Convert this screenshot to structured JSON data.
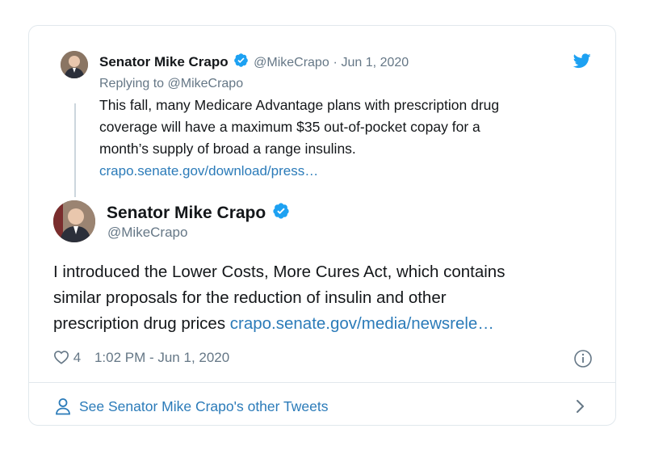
{
  "reply": {
    "display_name": "Senator Mike Crapo",
    "handle": "@MikeCrapo",
    "separator": "·",
    "date": "Jun 1, 2020",
    "replying_to": "Replying to @MikeCrapo",
    "text": "This fall, many Medicare Advantage plans with prescription drug coverage will have a maximum $35 out-of-pocket copay for a month’s supply of broad a range insulins.",
    "line1": "This fall, many Medicare Advantage plans with prescription drug",
    "line2": "coverage will have a maximum $35 out-of-pocket copay for a",
    "line3": "month’s supply of broad a range insulins.",
    "link": "crapo.senate.gov/download/press…"
  },
  "main": {
    "display_name": "Senator Mike Crapo",
    "handle": "@MikeCrapo",
    "line1": "I introduced the Lower Costs, More Cures Act, which contains",
    "line2": "similar proposals for the reduction of insulin and other",
    "line3_text": "prescription drug prices",
    "line3_link": "crapo.senate.gov/media/newsrele…",
    "like_count": "4",
    "timestamp": "1:02 PM - Jun 1, 2020"
  },
  "footer": {
    "see_more": "See Senator Mike Crapo's other Tweets"
  },
  "colors": {
    "twitter_blue": "#1da1f2",
    "link": "#2b7bb9",
    "muted": "#657786",
    "border": "#e1e8ed"
  },
  "icons": [
    "twitter-bird-icon",
    "verified-badge-icon",
    "heart-icon",
    "info-icon",
    "person-icon",
    "chevron-right-icon"
  ]
}
